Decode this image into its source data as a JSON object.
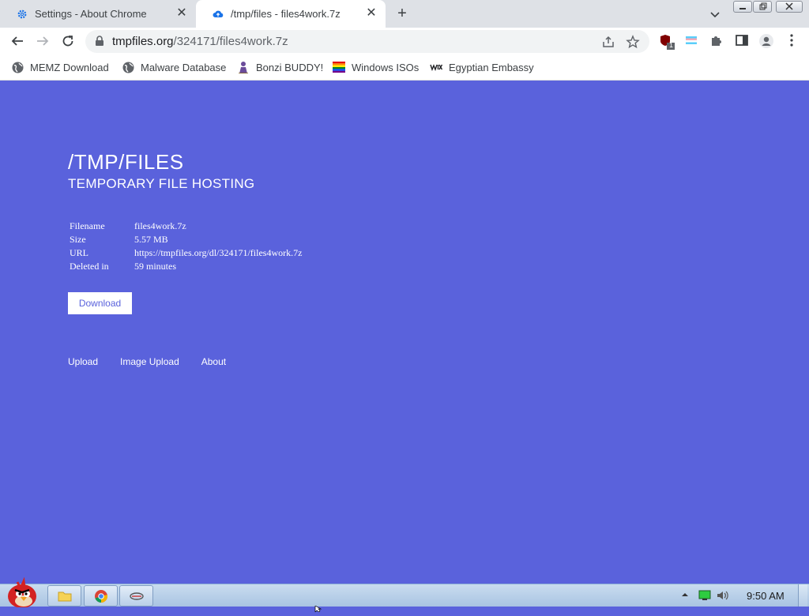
{
  "tabs": [
    {
      "title": "Settings - About Chrome",
      "icon": "gear-icon",
      "active": false
    },
    {
      "title": "/tmp/files - files4work.7z",
      "icon": "cloud-upload-icon",
      "active": true
    }
  ],
  "toolbar": {
    "url_host": "tmpfiles.org",
    "url_path": "/324171/files4work.7z",
    "extension_badge": "1"
  },
  "bookmarks": [
    {
      "label": "MEMZ Download",
      "icon": "globe-icon"
    },
    {
      "label": "Malware Database",
      "icon": "globe-icon"
    },
    {
      "label": "Bonzi BUDDY!",
      "icon": "bonzi-icon"
    },
    {
      "label": "Windows ISOs",
      "icon": "rainbow-flag-icon"
    },
    {
      "label": "Egyptian Embassy",
      "icon": "wix-icon"
    }
  ],
  "page": {
    "title": "/TMP/FILES",
    "subtitle": "TEMPORARY FILE HOSTING",
    "info": [
      {
        "key": "Filename",
        "value": "files4work.7z"
      },
      {
        "key": "Size",
        "value": "5.57 MB"
      },
      {
        "key": "URL",
        "value": "https://tmpfiles.org/dl/324171/files4work.7z"
      },
      {
        "key": "Deleted in",
        "value": "59 minutes"
      }
    ],
    "download_label": "Download",
    "footer_links": [
      "Upload",
      "Image Upload",
      "About"
    ],
    "background_color": "#5a62dc"
  },
  "taskbar": {
    "clock": "9:50 AM"
  }
}
